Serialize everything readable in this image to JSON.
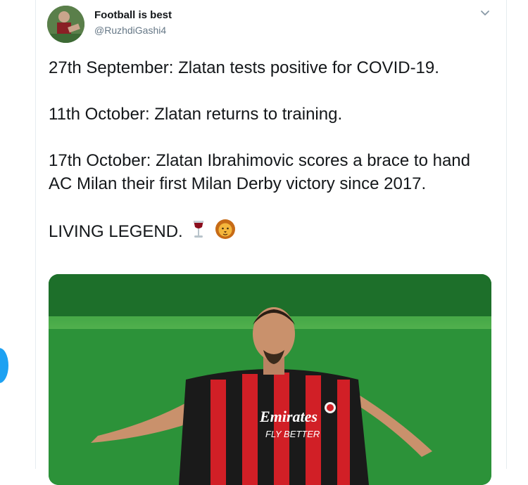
{
  "tweet": {
    "author": {
      "display_name": "Football is best",
      "handle": "@RuzhdiGashi4"
    },
    "paragraphs": [
      "27th September: Zlatan tests positive for COVID-19.",
      "11th October: Zlatan returns to training.",
      "17th October: Zlatan Ibrahimovic scores a brace to hand AC Milan their first Milan Derby victory since 2017.",
      "LIVING LEGEND."
    ],
    "emojis": [
      "wine-glass-icon",
      "lion-face-icon"
    ],
    "media": {
      "shirt_sponsor": "Emirates",
      "shirt_tagline": "FLY BETTER"
    }
  },
  "colors": {
    "text": "#14171a",
    "secondary_text": "#657786",
    "accent": "#1da1f2",
    "shirt_red": "#d11f26",
    "pitch_green": "#2f9a3c"
  }
}
